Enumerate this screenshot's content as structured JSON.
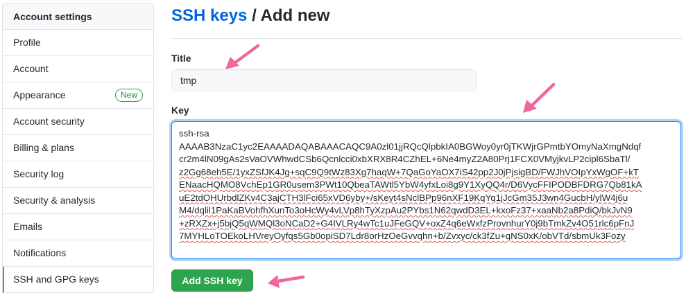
{
  "sidebar": {
    "header": "Account settings",
    "items": [
      {
        "label": "Profile"
      },
      {
        "label": "Account"
      },
      {
        "label": "Appearance",
        "badge": "New"
      },
      {
        "label": "Account security"
      },
      {
        "label": "Billing & plans"
      },
      {
        "label": "Security log"
      },
      {
        "label": "Security & analysis"
      },
      {
        "label": "Emails"
      },
      {
        "label": "Notifications"
      },
      {
        "label": "SSH and GPG keys",
        "selected": true
      }
    ]
  },
  "header": {
    "breadcrumb_link": "SSH keys",
    "breadcrumb_rest": " / Add new"
  },
  "form": {
    "title_label": "Title",
    "title_value": "tmp",
    "key_label": "Key",
    "key_lines": [
      "ssh-rsa",
      "AAAAB3NzaC1yc2EAAAADAQABAAACAQC9A0zl01jjRQcQlpbkIA0BGWoy0yr0jTKWjrGPmtbYOmyNaXmgNdqf",
      "cr2m4lN09gAs2sVaOVWhwdCSb6Qcnlcci0xbXRX8R4CZhEL+6Ne4myZ2A80Prj1FCX0VMyjkvLP2cipl6SbaTl/",
      "z2Gg68eh5E/1yxZSfJK4Jg+sqC9Q9tWz83Xg7haqW+7QaGoYaOX7iS42pp2J0jPjsigBD/FWJhVOIpYxWgOF+kT",
      "ENaacHQMO8VchEp1GR0usem3PWt10QbeaTAWtl5YbW4yfxLoi8g9Y1XyQQ4r/D6VycFFIPODBFDRG7Qb81kA",
      "uE2tdOHUrbdlZKv4C3ajCTH3lFci65xVD6yby+/sKeyt4sNclBPp96nXF19KqYq1jJcGm35J3wn4GucbH/ylW4j6u",
      "M4/dqlil1PaKaBVohfhXunTo3oHcWy4vLVp8hTyXzpAu2PYbs1N62qwdD3EL+kxoFz37+xaaNb2a8PdiQ/bkJvN9",
      "+zRXZx+j5bjQ5qWMQl3oNCaD2+G4IVLRy4wTc1uJFeGQV+oxZ4q6eWxfzProvnhurY0j9bTmkZv4O51rlc6pFnJ",
      "7MYHLoTOEkoLHVreyOyfqs5Gb0opiSD7Ldr8orHzOeGvvqhn+b/Zvxyc/ck3fZu+qNS0xK/obVTd/sbmUk3Fozy"
    ],
    "submit_label": "Add SSH key"
  },
  "colors": {
    "link": "#0366d6",
    "primary_button": "#2ea44f",
    "selected_marker": "#e36209",
    "badge": "#28a745",
    "annotation_arrow": "#f0679e"
  }
}
